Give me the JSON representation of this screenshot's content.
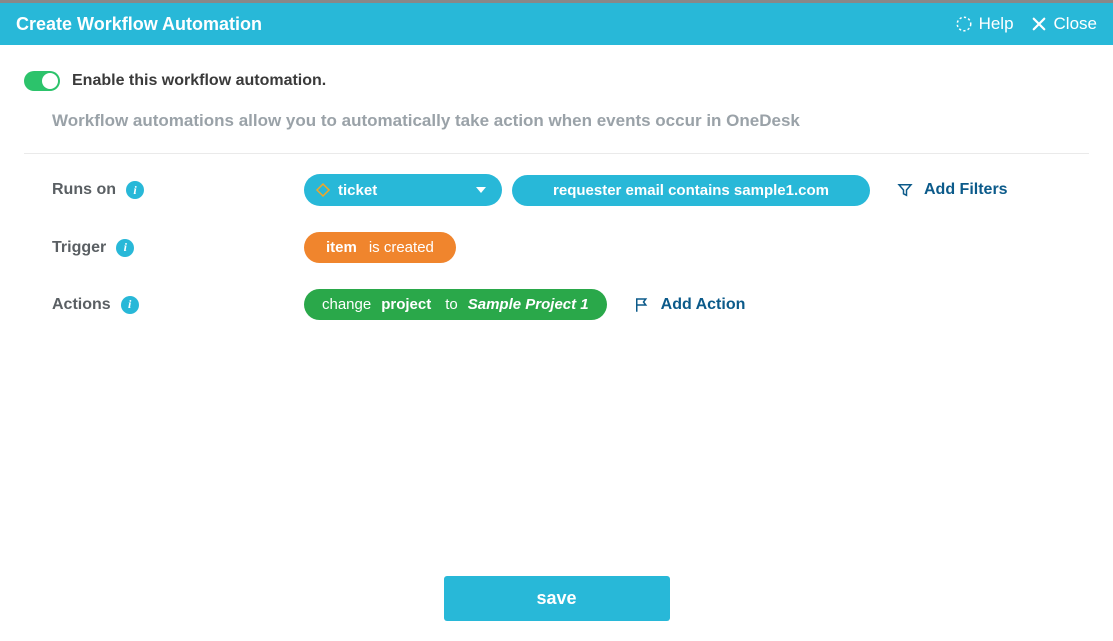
{
  "header": {
    "title": "Create Workflow Automation",
    "help_label": "Help",
    "close_label": "Close"
  },
  "toggle": {
    "label": "Enable this workflow automation.",
    "enabled": true
  },
  "description": "Workflow automations allow you to automatically take action when events occur in OneDesk",
  "rows": {
    "runs_on": {
      "label": "Runs on",
      "type_value": "ticket",
      "filter_text": "requester email contains sample1.com",
      "add_filters_label": "Add Filters"
    },
    "trigger": {
      "label": "Trigger",
      "subject": "item",
      "predicate": "is created"
    },
    "actions": {
      "label": "Actions",
      "change_word": "change",
      "field": "project",
      "to_word": "to",
      "value": "Sample Project 1",
      "add_action_label": "Add Action"
    }
  },
  "footer": {
    "save_label": "save"
  }
}
